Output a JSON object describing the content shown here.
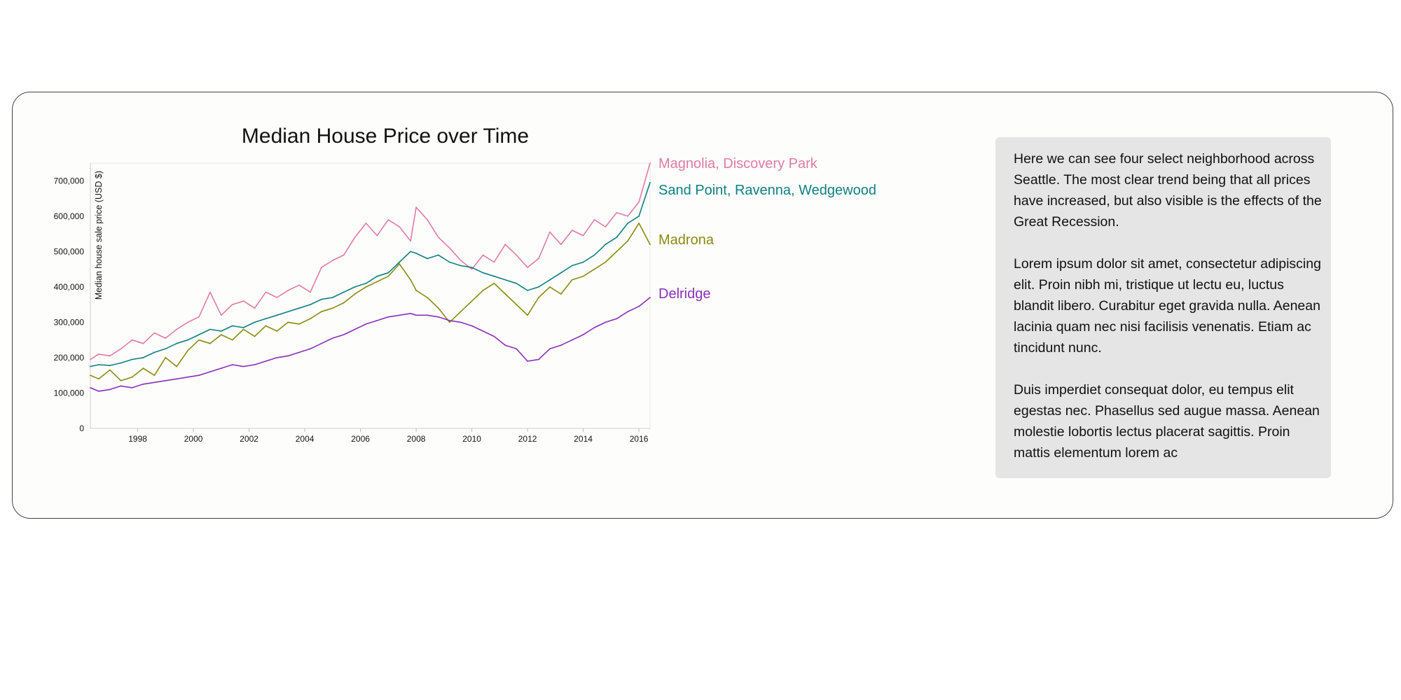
{
  "chart_data": {
    "type": "line",
    "title": "Median House Price over Time",
    "xlabel": "",
    "ylabel": "Median house sale price (USD $)",
    "xlim": [
      1996.3,
      2016.4
    ],
    "ylim": [
      0,
      750000
    ],
    "x_ticks": [
      1998,
      2000,
      2002,
      2004,
      2006,
      2008,
      2010,
      2012,
      2014,
      2016
    ],
    "y_ticks": [
      0,
      100000,
      200000,
      300000,
      400000,
      500000,
      600000,
      700000
    ],
    "y_tick_labels": [
      "0",
      "100,000",
      "200,000",
      "300,000",
      "400,000",
      "500,000",
      "600,000",
      "700,000"
    ],
    "grid": false,
    "legend": "right, direct labels",
    "series": [
      {
        "name": "Magnolia, Discovery Park",
        "color": "#e07aa6",
        "points": [
          [
            1996.3,
            195000
          ],
          [
            1996.6,
            210000
          ],
          [
            1997.0,
            205000
          ],
          [
            1997.4,
            225000
          ],
          [
            1997.8,
            250000
          ],
          [
            1998.2,
            240000
          ],
          [
            1998.6,
            270000
          ],
          [
            1999.0,
            255000
          ],
          [
            1999.4,
            280000
          ],
          [
            1999.8,
            300000
          ],
          [
            2000.2,
            315000
          ],
          [
            2000.6,
            385000
          ],
          [
            2001.0,
            320000
          ],
          [
            2001.4,
            350000
          ],
          [
            2001.8,
            360000
          ],
          [
            2002.2,
            340000
          ],
          [
            2002.6,
            385000
          ],
          [
            2003.0,
            370000
          ],
          [
            2003.4,
            390000
          ],
          [
            2003.8,
            405000
          ],
          [
            2004.2,
            385000
          ],
          [
            2004.6,
            455000
          ],
          [
            2005.0,
            475000
          ],
          [
            2005.4,
            490000
          ],
          [
            2005.8,
            540000
          ],
          [
            2006.2,
            580000
          ],
          [
            2006.6,
            545000
          ],
          [
            2007.0,
            590000
          ],
          [
            2007.4,
            570000
          ],
          [
            2007.8,
            530000
          ],
          [
            2008.0,
            625000
          ],
          [
            2008.4,
            590000
          ],
          [
            2008.8,
            540000
          ],
          [
            2009.2,
            510000
          ],
          [
            2009.6,
            475000
          ],
          [
            2010.0,
            450000
          ],
          [
            2010.4,
            490000
          ],
          [
            2010.8,
            470000
          ],
          [
            2011.2,
            520000
          ],
          [
            2011.6,
            490000
          ],
          [
            2012.0,
            455000
          ],
          [
            2012.4,
            480000
          ],
          [
            2012.8,
            555000
          ],
          [
            2013.2,
            520000
          ],
          [
            2013.6,
            560000
          ],
          [
            2014.0,
            545000
          ],
          [
            2014.4,
            590000
          ],
          [
            2014.8,
            570000
          ],
          [
            2015.2,
            610000
          ],
          [
            2015.6,
            600000
          ],
          [
            2016.0,
            640000
          ],
          [
            2016.4,
            750000
          ]
        ]
      },
      {
        "name": "Sand Point, Ravenna, Wedgewood",
        "color": "#0e8080",
        "points": [
          [
            1996.3,
            175000
          ],
          [
            1996.6,
            180000
          ],
          [
            1997.0,
            178000
          ],
          [
            1997.4,
            185000
          ],
          [
            1997.8,
            195000
          ],
          [
            1998.2,
            200000
          ],
          [
            1998.6,
            215000
          ],
          [
            1999.0,
            225000
          ],
          [
            1999.4,
            240000
          ],
          [
            1999.8,
            250000
          ],
          [
            2000.2,
            265000
          ],
          [
            2000.6,
            280000
          ],
          [
            2001.0,
            275000
          ],
          [
            2001.4,
            290000
          ],
          [
            2001.8,
            285000
          ],
          [
            2002.2,
            300000
          ],
          [
            2002.6,
            310000
          ],
          [
            2003.0,
            320000
          ],
          [
            2003.4,
            330000
          ],
          [
            2003.8,
            340000
          ],
          [
            2004.2,
            350000
          ],
          [
            2004.6,
            365000
          ],
          [
            2005.0,
            370000
          ],
          [
            2005.4,
            385000
          ],
          [
            2005.8,
            400000
          ],
          [
            2006.2,
            410000
          ],
          [
            2006.6,
            430000
          ],
          [
            2007.0,
            440000
          ],
          [
            2007.4,
            470000
          ],
          [
            2007.8,
            500000
          ],
          [
            2008.0,
            495000
          ],
          [
            2008.4,
            480000
          ],
          [
            2008.8,
            490000
          ],
          [
            2009.2,
            470000
          ],
          [
            2009.6,
            460000
          ],
          [
            2010.0,
            455000
          ],
          [
            2010.4,
            440000
          ],
          [
            2010.8,
            430000
          ],
          [
            2011.2,
            420000
          ],
          [
            2011.6,
            410000
          ],
          [
            2012.0,
            390000
          ],
          [
            2012.4,
            400000
          ],
          [
            2012.8,
            420000
          ],
          [
            2013.2,
            440000
          ],
          [
            2013.6,
            460000
          ],
          [
            2014.0,
            470000
          ],
          [
            2014.4,
            490000
          ],
          [
            2014.8,
            520000
          ],
          [
            2015.2,
            540000
          ],
          [
            2015.6,
            580000
          ],
          [
            2016.0,
            600000
          ],
          [
            2016.4,
            695000
          ]
        ]
      },
      {
        "name": "Madrona",
        "color": "#8a8a12",
        "points": [
          [
            1996.3,
            150000
          ],
          [
            1996.6,
            140000
          ],
          [
            1997.0,
            165000
          ],
          [
            1997.4,
            135000
          ],
          [
            1997.8,
            145000
          ],
          [
            1998.2,
            170000
          ],
          [
            1998.6,
            150000
          ],
          [
            1999.0,
            200000
          ],
          [
            1999.4,
            175000
          ],
          [
            1999.8,
            220000
          ],
          [
            2000.2,
            250000
          ],
          [
            2000.6,
            240000
          ],
          [
            2001.0,
            265000
          ],
          [
            2001.4,
            250000
          ],
          [
            2001.8,
            280000
          ],
          [
            2002.2,
            260000
          ],
          [
            2002.6,
            290000
          ],
          [
            2003.0,
            275000
          ],
          [
            2003.4,
            300000
          ],
          [
            2003.8,
            295000
          ],
          [
            2004.2,
            310000
          ],
          [
            2004.6,
            330000
          ],
          [
            2005.0,
            340000
          ],
          [
            2005.4,
            355000
          ],
          [
            2005.8,
            380000
          ],
          [
            2006.2,
            400000
          ],
          [
            2006.6,
            415000
          ],
          [
            2007.0,
            430000
          ],
          [
            2007.4,
            465000
          ],
          [
            2007.8,
            420000
          ],
          [
            2008.0,
            390000
          ],
          [
            2008.4,
            370000
          ],
          [
            2008.8,
            340000
          ],
          [
            2009.2,
            300000
          ],
          [
            2009.6,
            330000
          ],
          [
            2010.0,
            360000
          ],
          [
            2010.4,
            390000
          ],
          [
            2010.8,
            410000
          ],
          [
            2011.2,
            380000
          ],
          [
            2011.6,
            350000
          ],
          [
            2012.0,
            320000
          ],
          [
            2012.4,
            370000
          ],
          [
            2012.8,
            400000
          ],
          [
            2013.2,
            380000
          ],
          [
            2013.6,
            420000
          ],
          [
            2014.0,
            430000
          ],
          [
            2014.4,
            450000
          ],
          [
            2014.8,
            470000
          ],
          [
            2015.2,
            500000
          ],
          [
            2015.6,
            530000
          ],
          [
            2016.0,
            580000
          ],
          [
            2016.4,
            520000
          ]
        ]
      },
      {
        "name": "Delridge",
        "color": "#8a2fba",
        "points": [
          [
            1996.3,
            115000
          ],
          [
            1996.6,
            105000
          ],
          [
            1997.0,
            110000
          ],
          [
            1997.4,
            120000
          ],
          [
            1997.8,
            115000
          ],
          [
            1998.2,
            125000
          ],
          [
            1998.6,
            130000
          ],
          [
            1999.0,
            135000
          ],
          [
            1999.4,
            140000
          ],
          [
            1999.8,
            145000
          ],
          [
            2000.2,
            150000
          ],
          [
            2000.6,
            160000
          ],
          [
            2001.0,
            170000
          ],
          [
            2001.4,
            180000
          ],
          [
            2001.8,
            175000
          ],
          [
            2002.2,
            180000
          ],
          [
            2002.6,
            190000
          ],
          [
            2003.0,
            200000
          ],
          [
            2003.4,
            205000
          ],
          [
            2003.8,
            215000
          ],
          [
            2004.2,
            225000
          ],
          [
            2004.6,
            240000
          ],
          [
            2005.0,
            255000
          ],
          [
            2005.4,
            265000
          ],
          [
            2005.8,
            280000
          ],
          [
            2006.2,
            295000
          ],
          [
            2006.6,
            305000
          ],
          [
            2007.0,
            315000
          ],
          [
            2007.4,
            320000
          ],
          [
            2007.8,
            325000
          ],
          [
            2008.0,
            320000
          ],
          [
            2008.4,
            320000
          ],
          [
            2008.8,
            315000
          ],
          [
            2009.2,
            305000
          ],
          [
            2009.6,
            300000
          ],
          [
            2010.0,
            290000
          ],
          [
            2010.4,
            275000
          ],
          [
            2010.8,
            260000
          ],
          [
            2011.2,
            235000
          ],
          [
            2011.6,
            225000
          ],
          [
            2012.0,
            190000
          ],
          [
            2012.4,
            195000
          ],
          [
            2012.8,
            225000
          ],
          [
            2013.2,
            235000
          ],
          [
            2013.6,
            250000
          ],
          [
            2014.0,
            265000
          ],
          [
            2014.4,
            285000
          ],
          [
            2014.8,
            300000
          ],
          [
            2015.2,
            310000
          ],
          [
            2015.6,
            330000
          ],
          [
            2016.0,
            345000
          ],
          [
            2016.4,
            370000
          ]
        ]
      }
    ]
  },
  "description": {
    "paragraphs": [
      "Here we can see four select neighborhood across Seattle. The most clear trend being that all prices have increased, but also visible is the effects of the Great Recession.",
      "Lorem ipsum dolor sit amet, consectetur adipiscing elit. Proin nibh mi, tristique ut lectu eu, luctus blandit libero. Curabitur eget gravida nulla. Aenean lacinia quam nec nisi facilisis venenatis. Etiam ac tincidunt nunc.",
      "Duis imperdiet consequat dolor, eu tempus elit egestas nec. Phasellus sed augue massa. Aenean molestie lobortis lectus placerat sagittis. Proin mattis elementum lorem ac"
    ]
  }
}
